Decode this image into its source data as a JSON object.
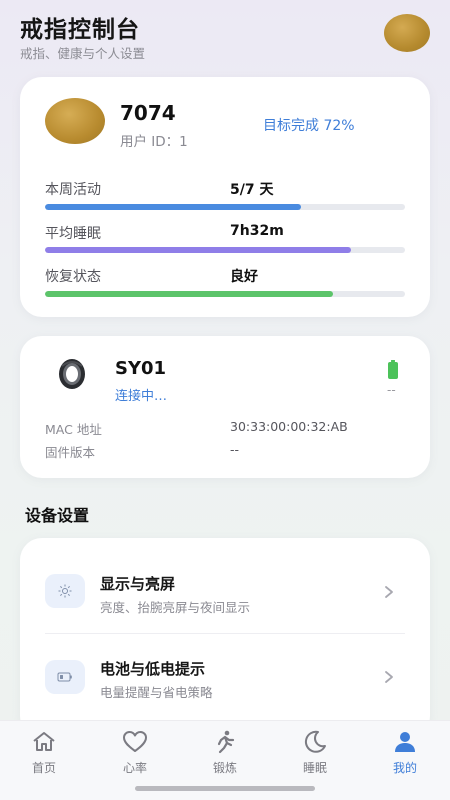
{
  "header": {
    "title": "戒指控制台",
    "subtitle": "戒指、健康与个人设置"
  },
  "profile": {
    "username": "7074",
    "user_id": "用户 ID：1",
    "goal_text": "目标完成 72%",
    "goal_percent": 72,
    "stats": [
      {
        "label": "本周活动",
        "value": "5/7 天",
        "progress": 0.71,
        "color": "#4a8be0"
      },
      {
        "label": "平均睡眠",
        "value": "7h32m",
        "progress": 0.85,
        "color": "#8f7ee8"
      },
      {
        "label": "恢复状态",
        "value": "良好",
        "progress": 0.8,
        "color": "#5cc46a"
      }
    ]
  },
  "device": {
    "name": "SY01",
    "status": "连接中…",
    "battery_text": "--",
    "battery_color": "#4cc25a",
    "info": [
      {
        "label": "MAC 地址",
        "value": "30:33:00:00:32:AB"
      },
      {
        "label": "固件版本",
        "value": "--"
      }
    ]
  },
  "settings": {
    "section_title": "设备设置",
    "items": [
      {
        "title": "显示与亮屏",
        "desc": "亮度、抬腕亮屏与夜间显示",
        "icon": "sun-icon"
      },
      {
        "title": "电池与低电提示",
        "desc": "电量提醒与省电策略",
        "icon": "battery-settings-icon"
      }
    ]
  },
  "nav": {
    "items": [
      {
        "label": "首页",
        "icon": "home-icon",
        "active": false
      },
      {
        "label": "心率",
        "icon": "heart-icon",
        "active": false
      },
      {
        "label": "锻炼",
        "icon": "running-icon",
        "active": false
      },
      {
        "label": "睡眠",
        "icon": "moon-icon",
        "active": false
      },
      {
        "label": "我的",
        "icon": "person-icon",
        "active": true
      }
    ],
    "accent": "#3f7ed8"
  }
}
